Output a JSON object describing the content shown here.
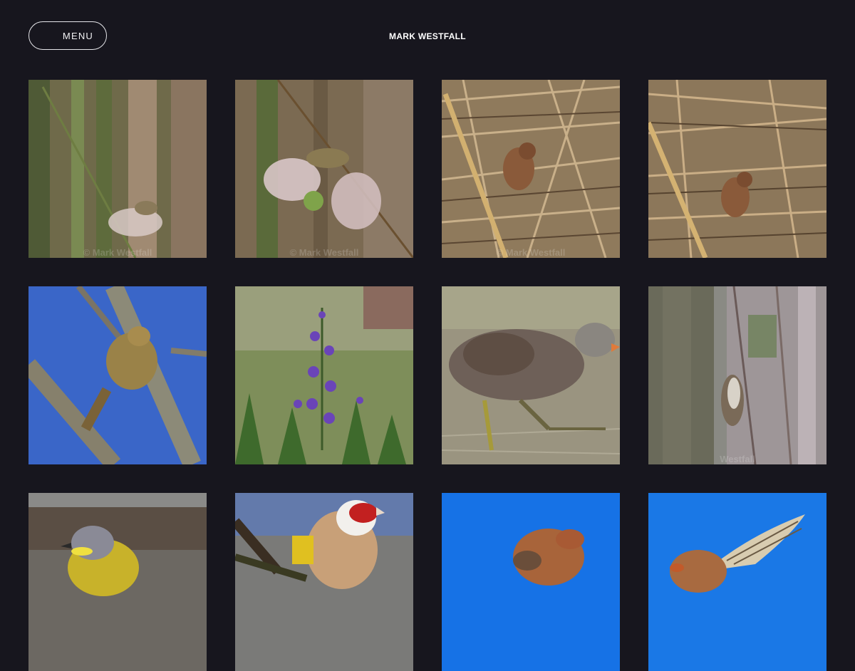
{
  "header": {
    "menu_label": "MENU",
    "site_title": "MARK WESTFALL"
  },
  "gallery": {
    "tiles": [
      {
        "alt": "warbler-reeds-1",
        "watermark": "© Mark Westfall"
      },
      {
        "alt": "warbler-reeds-2",
        "watermark": "© Mark Westfall"
      },
      {
        "alt": "wren-straw-1",
        "watermark": "© Mark Westfall"
      },
      {
        "alt": "wren-straw-2",
        "watermark": ""
      },
      {
        "alt": "chiffchaff-branch",
        "watermark": ""
      },
      {
        "alt": "purple-flower-spike",
        "watermark": ""
      },
      {
        "alt": "moorhen-water",
        "watermark": ""
      },
      {
        "alt": "treecreeper-trunk",
        "watermark": "Westfall"
      },
      {
        "alt": "yellow-wagtail",
        "watermark": ""
      },
      {
        "alt": "goldfinch",
        "watermark": ""
      },
      {
        "alt": "kestrel-blue-sky-1",
        "watermark": ""
      },
      {
        "alt": "kestrel-blue-sky-2",
        "watermark": ""
      }
    ]
  }
}
